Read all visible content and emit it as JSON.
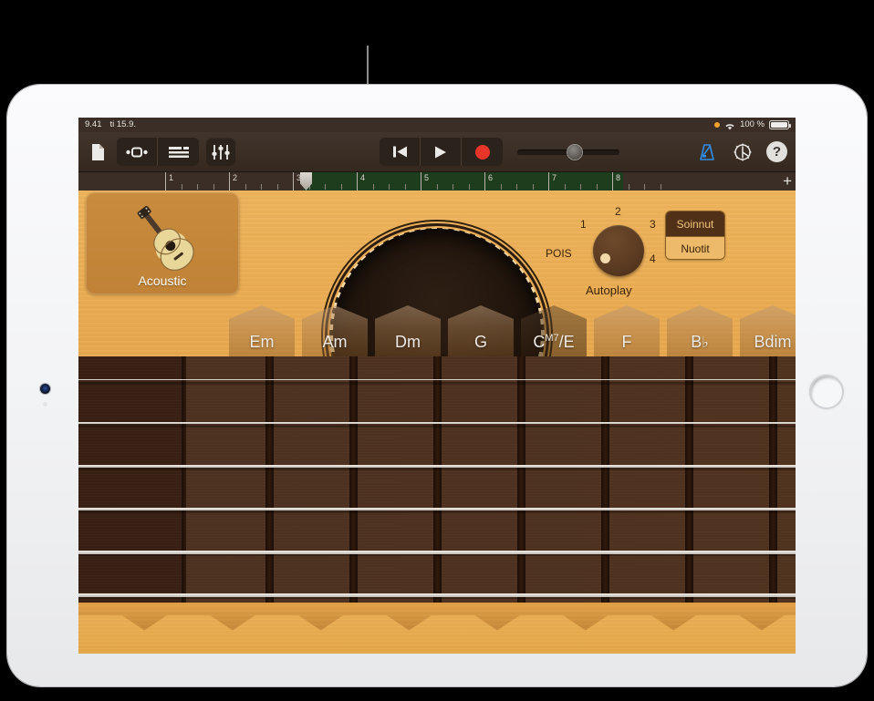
{
  "status_bar": {
    "time": "9.41",
    "date": "ti 15.9.",
    "battery_percent": "100 %",
    "icons": [
      "orange-recording-dot-icon",
      "wifi-icon",
      "battery-icon"
    ]
  },
  "toolbar": {
    "left_buttons": [
      {
        "name": "document-icon",
        "label": ""
      },
      {
        "name": "loop-browser-icon",
        "label": ""
      },
      {
        "name": "track-view-icon",
        "label": ""
      },
      {
        "name": "mixer-icon",
        "label": ""
      }
    ],
    "transport": {
      "rewind": "rewind-icon",
      "play": "play-icon",
      "record": "record-icon"
    },
    "volume": {
      "value": 50
    },
    "metronome": "metronome-icon",
    "settings": "gear-icon",
    "help": "?"
  },
  "ruler": {
    "bars": [
      "1",
      "2",
      "3",
      "4",
      "5",
      "6",
      "7",
      "8"
    ],
    "playhead_bar": "3",
    "add_button": "+",
    "cycle_region": {
      "start_bar": "3",
      "end_bar": "8"
    }
  },
  "instrument": {
    "name": "Acoustic",
    "icon": "acoustic-guitar-icon"
  },
  "autoplay": {
    "title": "Autoplay",
    "off_label": "POIS",
    "positions": [
      "1",
      "2",
      "3",
      "4"
    ],
    "selected": "POIS"
  },
  "mode_buttons": {
    "chords": {
      "label": "Soinnut",
      "active": true
    },
    "notes": {
      "label": "Nuotit",
      "active": false
    }
  },
  "chords": [
    {
      "label": "Em",
      "root": "Em",
      "sup": "",
      "suffix": "",
      "dark": false
    },
    {
      "label": "Am",
      "root": "Am",
      "sup": "",
      "suffix": "",
      "dark": false
    },
    {
      "label": "Dm",
      "root": "Dm",
      "sup": "",
      "suffix": "",
      "dark": false
    },
    {
      "label": "G",
      "root": "G",
      "sup": "",
      "suffix": "",
      "dark": false
    },
    {
      "label": "CM7/E",
      "root": "C",
      "sup": "M7",
      "suffix": "/E",
      "dark": true
    },
    {
      "label": "F",
      "root": "F",
      "sup": "",
      "suffix": "",
      "dark": false
    },
    {
      "label": "Bb",
      "root": "B",
      "sup": "",
      "suffix": "♭",
      "dark": false
    },
    {
      "label": "Bdim",
      "root": "Bdim",
      "sup": "",
      "suffix": "",
      "dark": false
    }
  ],
  "fretboard": {
    "string_count": 6,
    "fret_count": 5
  },
  "colors": {
    "guitar_top": "#e7a64b",
    "fretboard": "#50331f",
    "toolbar_bg": "#35291f",
    "record_red": "#e8352a",
    "metronome_blue": "#2f8ee8",
    "cycle_green": "#1d3d1c",
    "mode_active_bg": "#503016",
    "mode_inactive_bg": "#edb96b"
  }
}
